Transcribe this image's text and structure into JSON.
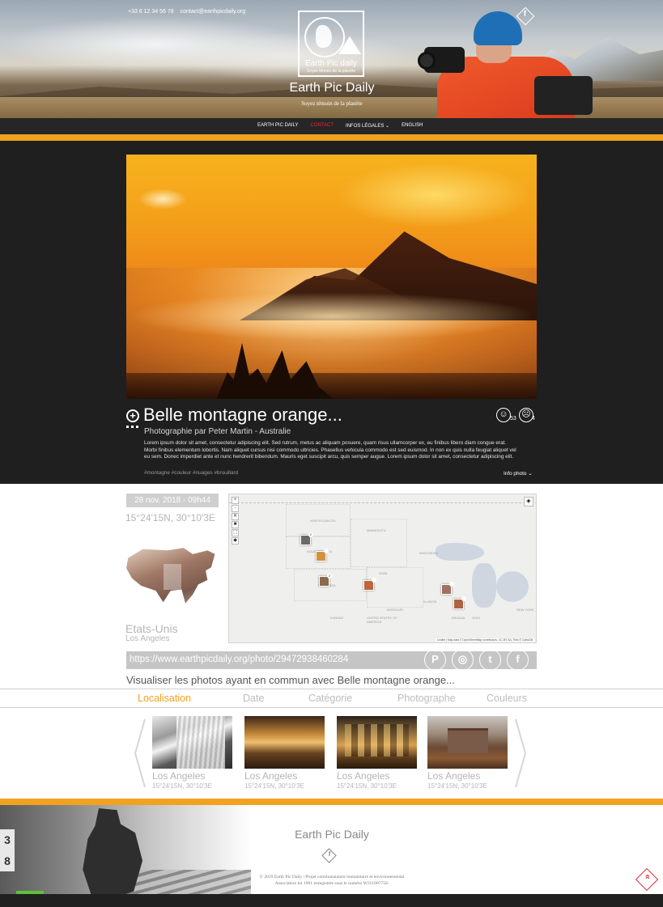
{
  "header": {
    "contact_phone": "+33 6 12 34 56 78",
    "contact_email": "contact@earthpicdaily.org",
    "logo_text": "Earth Pic daily",
    "logo_sub": "Soyez témoin de la planète",
    "site_title": "Earth Pic Daily",
    "tagline": "Soyez témoin de la planète",
    "facebook_glyph": "f"
  },
  "nav": {
    "items": [
      "EARTH PIC DAILY",
      "CONTACT",
      "INFOS LÉGALES ⌄",
      "ENGLISH"
    ],
    "active_index": 1
  },
  "photo": {
    "title": "Belle montagne orange...",
    "credit": "Photographie par Peter Martin - Australie",
    "description": "Lorem ipsum dolor sit amet, consectetur adipiscing elit. Sed rutrum, metus ac aliquam posuere, quam risus ullamcorper ex, eu finibus libero diam congue erat. Morbi finibus elementum lobortis. Nam aliquet cursus nisi commodo ultricies. Phasellus vehicula commodo est sed euismod. In non ex quis nulla feugiat aliquet vel eu sem. Donec imperdiet ante et nunc hendrerit bibendum. Mauris eget suscipit arcu, quis semper augue. Lorem ipsum dolor sit amet, consectetur adipiscing elit.",
    "tags": "#montagne #couleur #nuages #brouillard",
    "info_toggle": "Info photo ⌄",
    "plus_glyph": "+",
    "reactions": {
      "happy_count": "53",
      "sad_count": "4",
      "happy_glyph": "☺",
      "sad_glyph": "☹"
    }
  },
  "meta": {
    "date": "28 nov. 2018 - 09h44",
    "coords": "15°24'15N, 30°10'3E",
    "country": "Etats-Unis",
    "city": "Los Angeles"
  },
  "map": {
    "controls": [
      "+",
      "-",
      "✕",
      "■",
      "⬚",
      "◆"
    ],
    "layers_glyph": "◈",
    "labels": [
      "NORTH DAKOTA",
      "SOUTH DAKOTA",
      "NEBRASKA",
      "IOWA",
      "KANSAS",
      "MISSOURI",
      "ILLINOIS",
      "WISCONSIN",
      "MINNESOTA",
      "UNITED STATES OF AMERICA",
      "OHIO",
      "INDIANA",
      "NEW YORK"
    ],
    "markers": [
      {
        "badge": "2",
        "color": "#6a6a6a"
      },
      {
        "badge": "",
        "color": "#d4903a"
      },
      {
        "badge": "2",
        "color": "#8a6a4a"
      },
      {
        "badge": "",
        "color": "#c0643a"
      },
      {
        "badge": "",
        "color": "#a07060"
      },
      {
        "badge": "",
        "color": "#b06040"
      }
    ],
    "attribution": "Leaflet | Map data © OpenStreetMap contributors, CC-BY-SA, Tiles © CartoDB"
  },
  "share": {
    "url": "https://www.earthpicdaily.org/photo/29472938460284",
    "pinterest": "P",
    "instagram": "◎",
    "twitter": "t",
    "facebook": "f"
  },
  "common": {
    "title": "Visualiser les photos ayant en commun avec Belle montagne orange..."
  },
  "tabs": [
    "Localisation",
    "Date",
    "Catégorie",
    "Photographe",
    "Couleurs"
  ],
  "carousel": [
    {
      "city": "Los Angeles",
      "coords": "15°24'15N, 30°10'3E"
    },
    {
      "city": "Los Angeles",
      "coords": "15°24'15N, 30°10'3E"
    },
    {
      "city": "Los Angeles",
      "coords": "15°24'15N, 30°10'3E"
    },
    {
      "city": "Los Angeles",
      "coords": "15°24'15N, 30°10'3E"
    }
  ],
  "footer": {
    "title": "Earth Pic Daily",
    "facebook_glyph": "f",
    "copy_line1": "© 2019 Earth Pic Daily | Projet communautaire humanitaire et environnemental",
    "copy_line2": "Association loi 1901 enregistrée sous le numéro W311007758.",
    "sign_text": "3 8",
    "back_top_glyph": "»"
  },
  "colors": {
    "accent": "#f1a21f",
    "active_nav": "#e0293a",
    "dark_bg": "#1f1f1f"
  }
}
